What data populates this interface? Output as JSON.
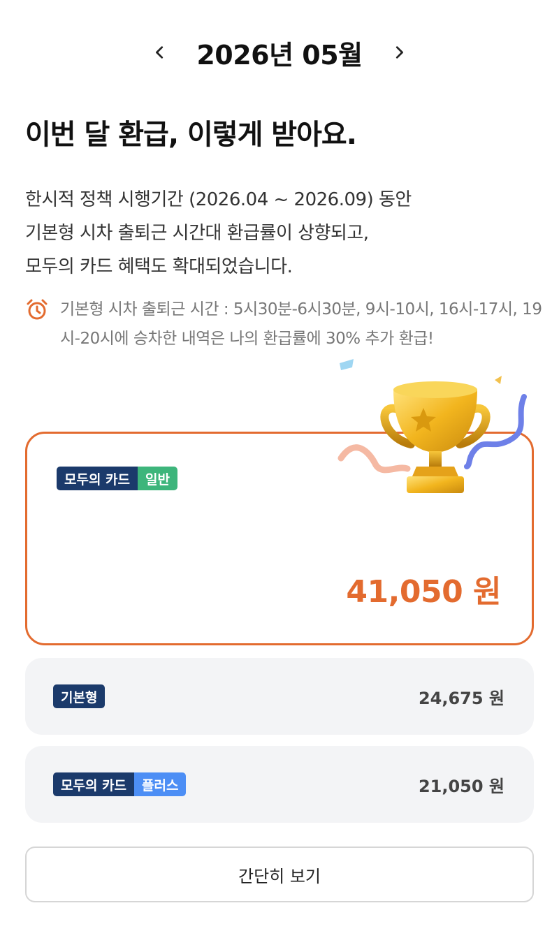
{
  "header": {
    "month_title": "2026년 05월",
    "prev_icon": "chevron-left-icon",
    "next_icon": "chevron-right-icon"
  },
  "headline": "이번 달 환급, 이렇게 받아요.",
  "description": {
    "lines": [
      "한시적 정책 시행기간 (2026.04 ~ 2026.09) 동안",
      "기본형 시차 출퇴근 시간대 환급률이 상향되고,",
      "모두의 카드 혜택도 확대되었습니다."
    ]
  },
  "notice": {
    "icon": "alarm-clock-icon",
    "text": "기본형 시차 출퇴근 시간 : 5시30분-6시30분, 9시-10시, 16시-17시, 19시-20시에 승차한 내역은 나의 환급률에 30% 추가 환급!"
  },
  "main_card": {
    "badge_primary": "모두의 카드",
    "badge_secondary": "일반",
    "amount": "41,050 원",
    "decoration": "trophy-icon"
  },
  "rows": [
    {
      "badge_primary": "기본형",
      "amount": "24,675 원"
    },
    {
      "badge_primary": "모두의 카드",
      "badge_secondary": "플러스",
      "amount": "21,050 원"
    }
  ],
  "simple_view_button": "간단히 보기",
  "colors": {
    "accent": "#E36B2F",
    "navy": "#1B3A6B",
    "green": "#3DB57B",
    "blue": "#4C8EF5",
    "row_bg": "#F3F4F6"
  }
}
